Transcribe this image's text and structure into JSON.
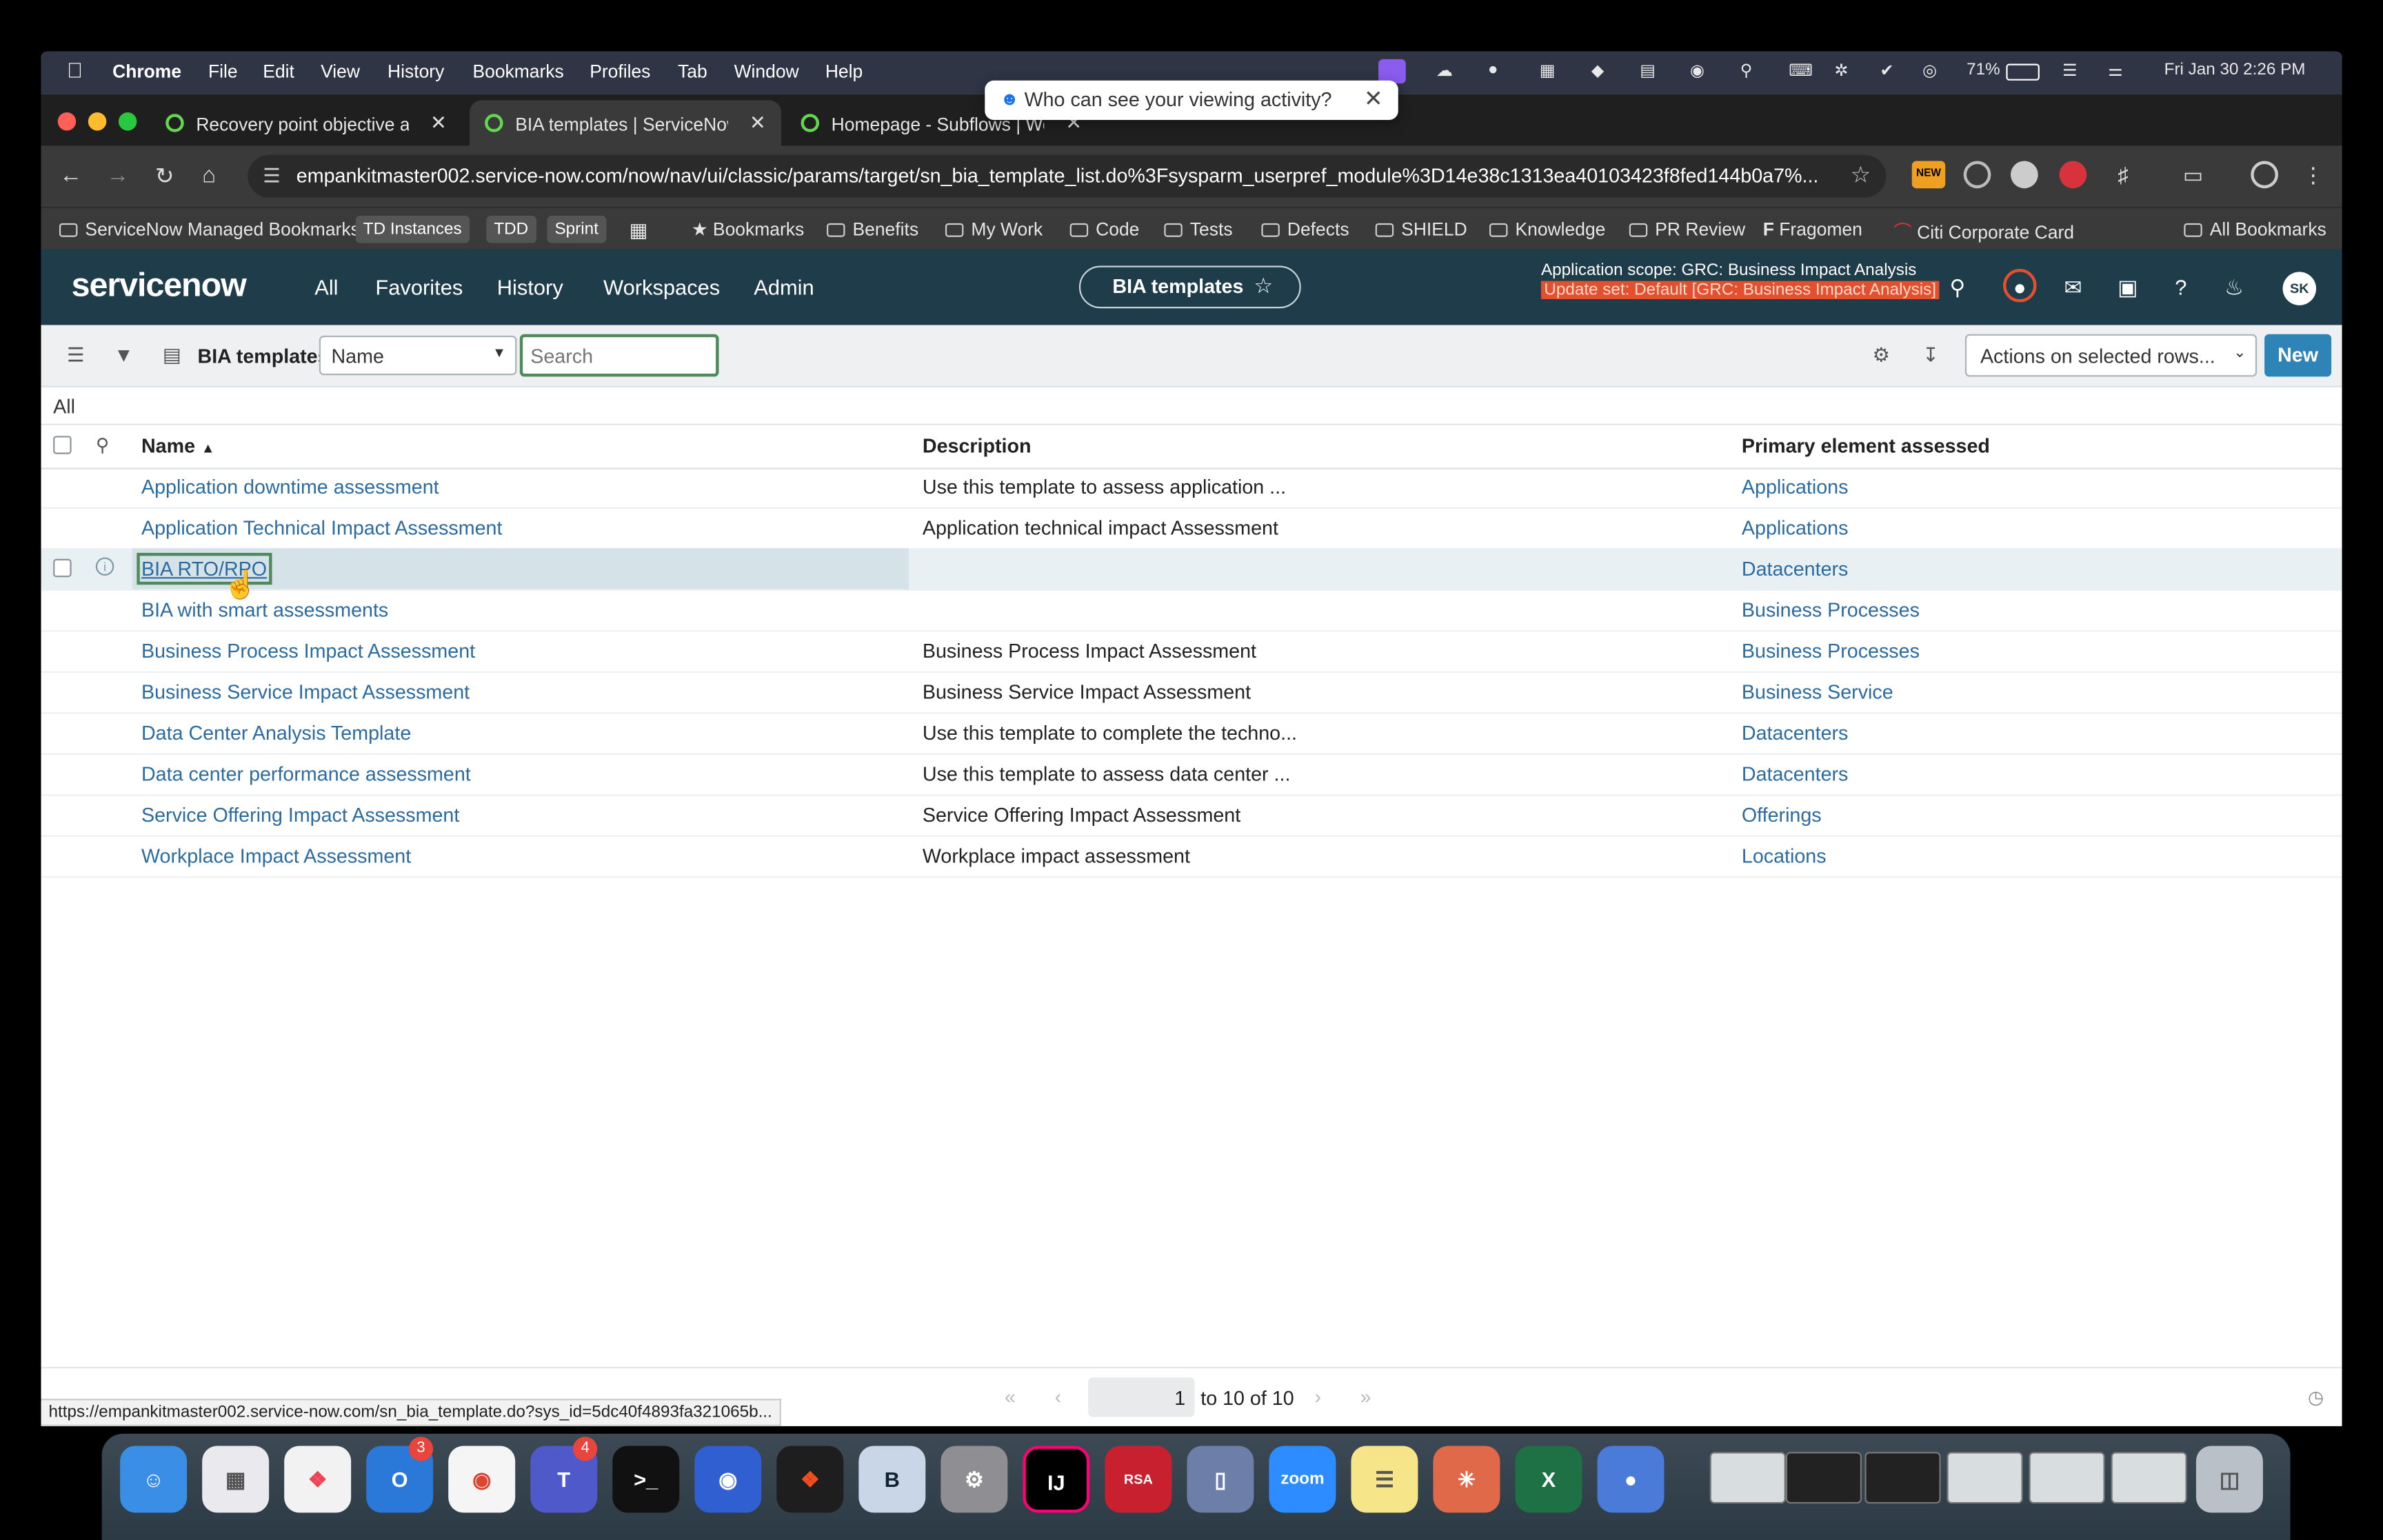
{
  "menubar": {
    "app": "Chrome",
    "items": [
      "File",
      "Edit",
      "View",
      "History",
      "Bookmarks",
      "Profiles",
      "Tab",
      "Window",
      "Help"
    ],
    "battery": "71%",
    "datetime": "Fri Jan 30  2:26 PM"
  },
  "popup": {
    "text": "Who can see your viewing activity?"
  },
  "tabs": [
    {
      "label": "Recovery point objective ass"
    },
    {
      "label": "BIA templates | ServiceNow"
    },
    {
      "label": "Homepage - Subflows | Work"
    }
  ],
  "address": {
    "url": "empankitmaster002.service-now.com/now/nav/ui/classic/params/target/sn_bia_template_list.do%3Fsysparm_userpref_module%3D14e38c1313ea40103423f8fed144b0a7%..."
  },
  "ext_new_badge": "NEW",
  "bookmarks": {
    "managed": "ServiceNow Managed Bookmarks",
    "chips": [
      "TD Instances",
      "TDD",
      "Sprint"
    ],
    "items": [
      "Bookmarks",
      "Benefits",
      "My Work",
      "Code",
      "Tests",
      "Defects",
      "SHIELD",
      "Knowledge",
      "PR Review",
      "Fragomen",
      "Citi Corporate Card"
    ],
    "all": "All Bookmarks"
  },
  "sn": {
    "logo": "servicenow",
    "nav": [
      "All",
      "Favorites",
      "History",
      "Workspaces",
      "Admin"
    ],
    "page_pill": "BIA templates",
    "scope": "Application scope: GRC: Business Impact Analysis",
    "update_set": "Update set: Default [GRC: Business Impact Analysis]",
    "avatar": "SK"
  },
  "list": {
    "title": "BIA templates",
    "field": "Name",
    "search_placeholder": "Search",
    "actions": "Actions on selected rows...",
    "new_label": "New",
    "breadcrumb": "All",
    "headers": [
      "Name",
      "Description",
      "Primary element assessed"
    ],
    "rows": [
      {
        "name": "Application downtime assessment",
        "desc": "Use this template to assess application ...",
        "element": "Applications"
      },
      {
        "name": "Application Technical Impact Assessment",
        "desc": "Application technical impact Assessment",
        "element": "Applications"
      },
      {
        "name": "BIA RTO/RPO",
        "desc": "",
        "element": "Datacenters"
      },
      {
        "name": "BIA with smart assessments",
        "desc": "",
        "element": "Business Processes"
      },
      {
        "name": "Business Process Impact Assessment",
        "desc": "Business Process Impact Assessment",
        "element": "Business Processes"
      },
      {
        "name": "Business Service Impact Assessment",
        "desc": "Business Service Impact Assessment",
        "element": "Business Service"
      },
      {
        "name": "Data Center Analysis Template",
        "desc": "Use this template to complete the techno...",
        "element": "Datacenters"
      },
      {
        "name": "Data center performance assessment",
        "desc": "Use this template to assess data center ...",
        "element": "Datacenters"
      },
      {
        "name": "Service Offering Impact Assessment",
        "desc": "Service Offering Impact Assessment",
        "element": "Offerings"
      },
      {
        "name": "Workplace Impact Assessment",
        "desc": "Workplace impact assessment",
        "element": "Locations"
      }
    ],
    "page": "1",
    "range": "to 10 of 10"
  },
  "status_url": "https://empankitmaster002.service-now.com/sn_bia_template.do?sys_id=5dc40f4893fa321065b...",
  "dock": {
    "badges": {
      "outlook": "3",
      "teams": "4"
    },
    "zoom": "zoom",
    "bbedit": "B",
    "intellij": "IJ"
  },
  "colors": {
    "sn_header": "#1f3c4a",
    "link": "#2c6ba0",
    "new_button": "#2e84b7",
    "update_set_bg": "#e2502f"
  }
}
